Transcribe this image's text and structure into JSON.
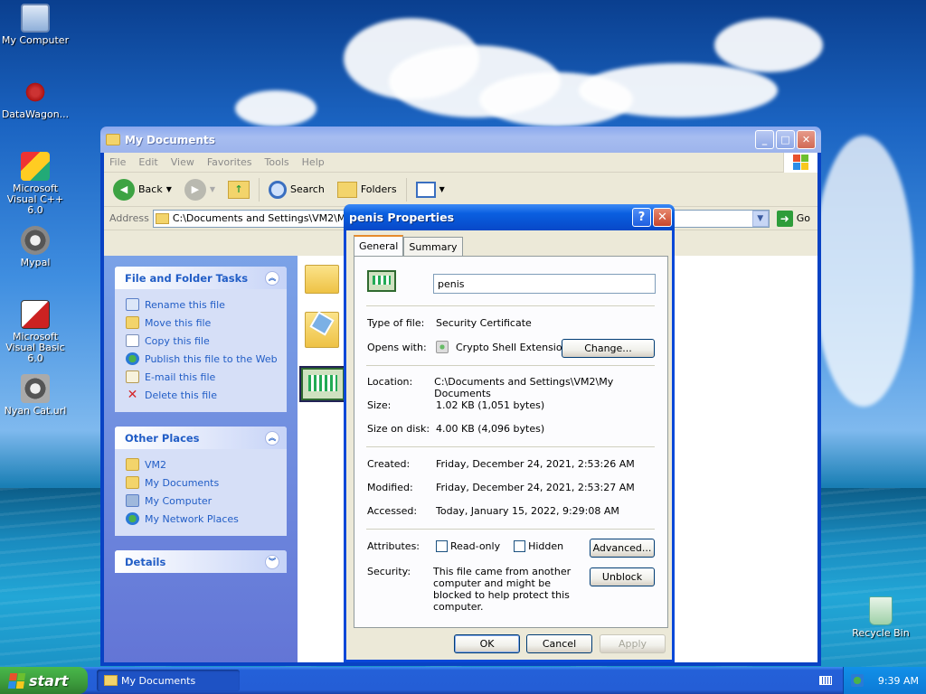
{
  "desktop": {
    "icons": [
      {
        "label": "My Computer"
      },
      {
        "label": "DataWagon..."
      },
      {
        "label": "Microsoft Visual C++ 6.0"
      },
      {
        "label": "Mypal"
      },
      {
        "label": "Microsoft Visual Basic 6.0"
      },
      {
        "label": "Nyan Cat.url"
      },
      {
        "label": "Recycle Bin"
      }
    ]
  },
  "explorer": {
    "title": "My Documents",
    "menu": [
      "File",
      "Edit",
      "View",
      "Favorites",
      "Tools",
      "Help"
    ],
    "toolbar": {
      "back": "Back",
      "search": "Search",
      "folders": "Folders"
    },
    "address_label": "Address",
    "address_value": "C:\\Documents and Settings\\VM2\\My Documents",
    "go_label": "Go",
    "file_tasks": {
      "title": "File and Folder Tasks",
      "items": [
        "Rename this file",
        "Move this file",
        "Copy this file",
        "Publish this file to the Web",
        "E-mail this file",
        "Delete this file"
      ]
    },
    "other_places": {
      "title": "Other Places",
      "items": [
        "VM2",
        "My Documents",
        "My Computer",
        "My Network Places"
      ]
    },
    "details": {
      "title": "Details"
    }
  },
  "dialog": {
    "title": "penis Properties",
    "tabs": [
      "General",
      "Summary"
    ],
    "file_name": "penis",
    "type_label": "Type of file:",
    "type_value": "Security Certificate",
    "opens_label": "Opens with:",
    "opens_value": "Crypto Shell Extension",
    "change_button": "Change...",
    "location_label": "Location:",
    "location_value": "C:\\Documents and Settings\\VM2\\My Documents",
    "size_label": "Size:",
    "size_value": "1.02 KB (1,051 bytes)",
    "disk_label": "Size on disk:",
    "disk_value": "4.00 KB (4,096 bytes)",
    "created_label": "Created:",
    "created_value": "Friday, December 24, 2021, 2:53:26 AM",
    "modified_label": "Modified:",
    "modified_value": "Friday, December 24, 2021, 2:53:27 AM",
    "accessed_label": "Accessed:",
    "accessed_value": "Today, January 15, 2022, 9:29:08 AM",
    "attributes_label": "Attributes:",
    "readonly_label": "Read-only",
    "hidden_label": "Hidden",
    "advanced_button": "Advanced...",
    "security_label": "Security:",
    "security_text": "This file came from another computer and might be blocked to help protect this computer.",
    "unblock_button": "Unblock",
    "ok_button": "OK",
    "cancel_button": "Cancel",
    "apply_button": "Apply"
  },
  "taskbar": {
    "start": "start",
    "task": "My Documents",
    "clock": "9:39 AM"
  }
}
